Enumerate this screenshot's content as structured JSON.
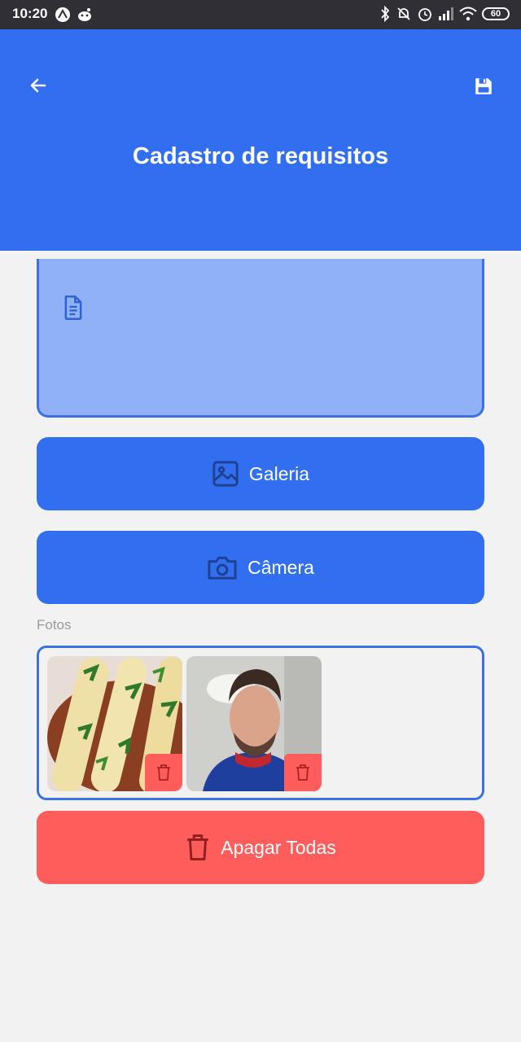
{
  "status_bar": {
    "time": "10:20",
    "battery": "60",
    "left_icons": [
      "expo-icon",
      "reddit-icon"
    ],
    "right_icons": [
      "bluetooth-icon",
      "notifications-off-icon",
      "alarm-icon",
      "signal-icon",
      "wifi-icon"
    ]
  },
  "header": {
    "title": "Cadastro de requisitos",
    "back_icon": "arrow-left-icon",
    "save_icon": "floppy-disk-icon",
    "color": "#316ff0"
  },
  "form": {
    "description_icon": "document-icon",
    "gallery_button": {
      "label": "Galeria",
      "icon": "image-icon"
    },
    "camera_button": {
      "label": "Câmera",
      "icon": "camera-icon"
    },
    "photos_label": "Fotos",
    "photos": [
      {
        "subject": "food",
        "delete_icon": "trash-icon"
      },
      {
        "subject": "person",
        "delete_icon": "trash-icon"
      }
    ],
    "delete_all_button": {
      "label": "Apagar Todas",
      "icon": "trash-icon",
      "color": "#ff5c5c"
    }
  }
}
